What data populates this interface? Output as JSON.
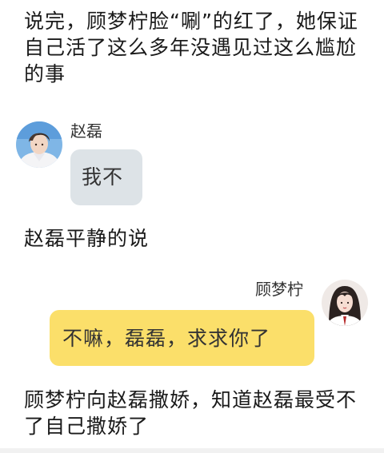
{
  "narration": [
    "说完，顾梦柠脸“唰”的红了，她保证自己活了这么多年没遇见过这么尴尬的事",
    "赵磊平静的说",
    "顾梦柠向赵磊撒娇，知道赵磊最受不了自己撒娇了"
  ],
  "messages": [
    {
      "sender": "赵磊",
      "text": "我不",
      "side": "left",
      "bubble_color": "#dde3e7"
    },
    {
      "sender": "顾梦柠",
      "text": "不嘛，磊磊，求求你了",
      "side": "right",
      "bubble_color": "#fbdf6a"
    }
  ]
}
